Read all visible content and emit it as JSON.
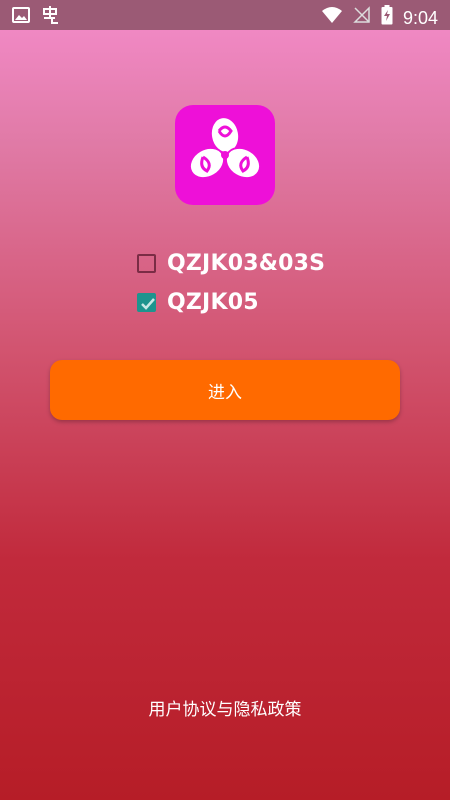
{
  "status_bar": {
    "time": "9:04",
    "icons_left": [
      "image-icon",
      "app-notification-icon"
    ],
    "icons_right": [
      "wifi-icon",
      "no-signal-icon",
      "battery-charging-icon"
    ]
  },
  "logo": {
    "icon": "flower-logo-icon",
    "background_color": "#ee10d8"
  },
  "options": [
    {
      "label": "QZJK03&03S",
      "checked": false
    },
    {
      "label": "QZJK05",
      "checked": true
    }
  ],
  "enter_button": {
    "label": "进入",
    "color": "#ff6a00"
  },
  "policy_link": {
    "label": "用户协议与隐私政策"
  },
  "colors": {
    "checkbox_checked": "#1d948e",
    "status_bar": "#9b5a75"
  }
}
